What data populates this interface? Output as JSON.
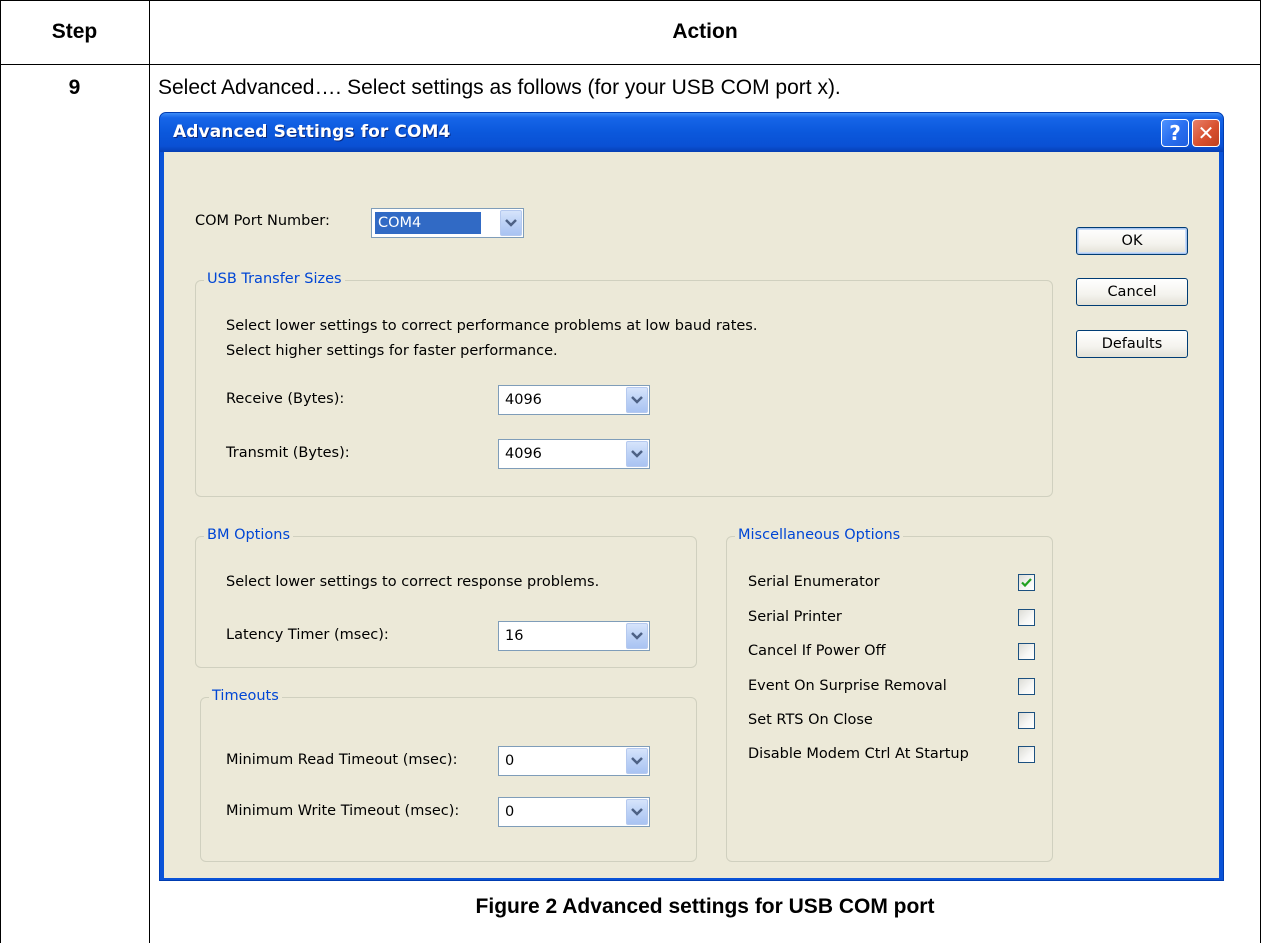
{
  "table": {
    "header_step": "Step",
    "header_action": "Action",
    "step_number": "9",
    "instruction": "Select Advanced…. Select settings as follows (for your USB COM port x).",
    "caption": "Figure 2 Advanced settings for USB COM port"
  },
  "dialog": {
    "title": "Advanced Settings for COM4",
    "help_glyph": "?",
    "close_glyph": "✕",
    "com_port_label": "COM Port Number:",
    "com_port_value": "COM4",
    "buttons": {
      "ok": "OK",
      "cancel": "Cancel",
      "defaults": "Defaults"
    },
    "usb_transfer": {
      "title": "USB Transfer Sizes",
      "desc_line1": "Select lower settings to correct performance problems at low baud rates.",
      "desc_line2": "Select higher settings for faster performance.",
      "receive_label": "Receive (Bytes):",
      "receive_value": "4096",
      "transmit_label": "Transmit (Bytes):",
      "transmit_value": "4096"
    },
    "bm_options": {
      "title": "BM Options",
      "desc": "Select lower settings to correct response problems.",
      "latency_label": "Latency Timer (msec):",
      "latency_value": "16"
    },
    "timeouts": {
      "title": "Timeouts",
      "read_label": "Minimum Read Timeout (msec):",
      "read_value": "0",
      "write_label": "Minimum Write Timeout (msec):",
      "write_value": "0"
    },
    "misc": {
      "title": "Miscellaneous Options",
      "items": [
        {
          "label": "Serial Enumerator",
          "checked": true
        },
        {
          "label": "Serial Printer",
          "checked": false
        },
        {
          "label": "Cancel If Power Off",
          "checked": false
        },
        {
          "label": "Event On Surprise Removal",
          "checked": false
        },
        {
          "label": "Set RTS On Close",
          "checked": false
        },
        {
          "label": "Disable Modem Ctrl At Startup",
          "checked": false
        }
      ]
    }
  },
  "colors": {
    "titlebar": "#0a53d8",
    "group_title": "#0046d5",
    "dialog_bg": "#ece9d8",
    "selection": "#316ac5",
    "check": "#21a121"
  }
}
